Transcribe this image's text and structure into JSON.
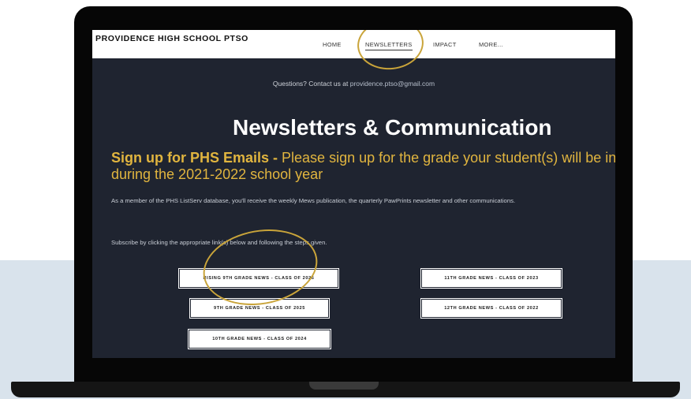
{
  "site": {
    "brand": "PROVIDENCE HIGH SCHOOL PTSO",
    "nav": [
      {
        "label": "HOME",
        "active": false
      },
      {
        "label": "NEWSLETTERS",
        "active": true
      },
      {
        "label": "IMPACT",
        "active": false
      },
      {
        "label": "MORE...",
        "active": false
      }
    ]
  },
  "contact": {
    "prefix": "Questions? Contact us at ",
    "email": "providence.ptso@gmail.com"
  },
  "main": {
    "title": "Newsletters & Communication",
    "signup_bold": "Sign up for PHS Emails -",
    "signup_text": " Please sign up for the grade your student(s) will be in during the 2021-2022 school year",
    "para1": "As a member of the PHS ListServ database, you'll receive the weekly Mews publication, the quarterly PawPrints newsletter and other communications.",
    "para2": "Subscribe by clicking the appropriate link(s) below and following the steps given."
  },
  "grade_buttons": [
    "RISING 9TH GRADE NEWS - CLASS OF 2026",
    "9TH GRADE NEWS - CLASS OF 2025",
    "10TH GRADE NEWS - CLASS OF 2024",
    "11TH GRADE NEWS - CLASS OF 2023",
    "12TH GRADE NEWS - CLASS OF 2022"
  ],
  "colors": {
    "accent_gold": "#e1b53f",
    "annotation_ring": "#c9a43a",
    "page_background": "#1f2430"
  }
}
